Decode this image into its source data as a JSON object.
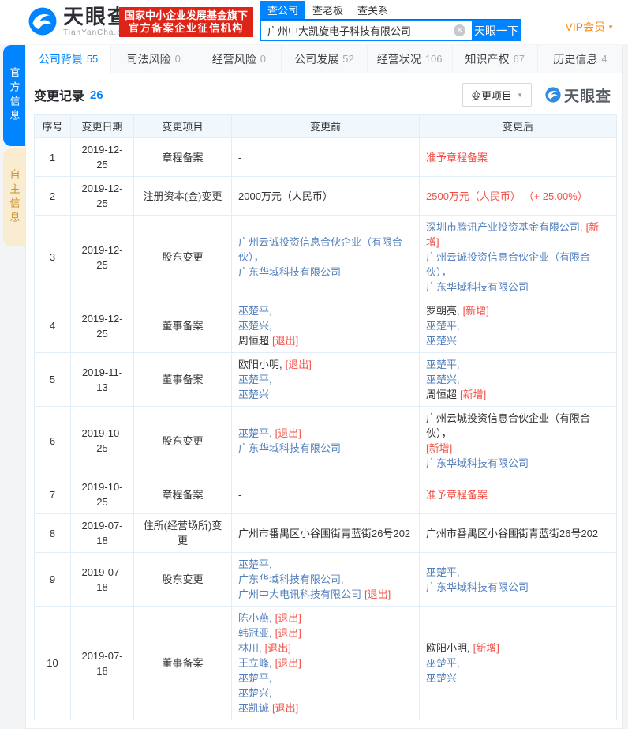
{
  "header": {
    "logo": {
      "brand": "天眼查",
      "domain": "TianYanCha.com"
    },
    "badge": {
      "line1": "国家中小企业发展基金旗下",
      "line2": "官方备案企业征信机构"
    },
    "search_tabs": [
      {
        "name": "search-tab-company",
        "label": "查公司",
        "active": true
      },
      {
        "name": "search-tab-boss",
        "label": "查老板",
        "active": false
      },
      {
        "name": "search-tab-relation",
        "label": "查关系",
        "active": false
      }
    ],
    "search": {
      "value": "广州中大凯旋电子科技有限公司",
      "button_label": "天眼一下"
    },
    "vip_label": "VIP会员"
  },
  "side_tabs": [
    {
      "name": "side-tab-official-info",
      "label": "官方信息",
      "active": true
    },
    {
      "name": "side-tab-self-info",
      "label": "自主信息",
      "active": false
    }
  ],
  "nav_tabs": [
    {
      "name": "tab-company-background",
      "label": "公司背景",
      "count": "55",
      "active": true
    },
    {
      "name": "tab-judicial-risk",
      "label": "司法风险",
      "count": "0",
      "active": false
    },
    {
      "name": "tab-operation-risk",
      "label": "经营风险",
      "count": "0",
      "active": false
    },
    {
      "name": "tab-company-development",
      "label": "公司发展",
      "count": "52",
      "active": false
    },
    {
      "name": "tab-operation-status",
      "label": "经营状况",
      "count": "106",
      "active": false
    },
    {
      "name": "tab-intellectual-property",
      "label": "知识产权",
      "count": "67",
      "active": false
    },
    {
      "name": "tab-history-info",
      "label": "历史信息",
      "count": "4",
      "active": false
    }
  ],
  "section": {
    "title": "变更记录",
    "count": "26",
    "filter_label": "变更项目",
    "watermark_label": "天眼查"
  },
  "colors": {
    "brand_blue": "#0084ff",
    "link_blue": "#5380bd",
    "alert_red": "#f25046",
    "badge_red": "#de2417",
    "vip_orange": "#ff8b17"
  },
  "table": {
    "headers": [
      "序号",
      "变更日期",
      "变更项目",
      "变更前",
      "变更后"
    ],
    "rows": [
      {
        "no": "1",
        "date": "2019-12-25",
        "item": "章程备案",
        "before": [
          [
            [
              "-",
              "plain"
            ]
          ]
        ],
        "after": [
          [
            [
              "准予章程备案",
              "red"
            ]
          ]
        ]
      },
      {
        "no": "2",
        "date": "2019-12-25",
        "item": "注册资本(金)变更",
        "before": [
          [
            [
              "2000万元（人民币）",
              "plain"
            ]
          ]
        ],
        "after": [
          [
            [
              "2500万元（人民币） （+ 25.00%）",
              "red"
            ]
          ]
        ]
      },
      {
        "no": "3",
        "date": "2019-12-25",
        "item": "股东变更",
        "before": [
          [
            [
              "广州云诚投资信息合伙企业（有限合伙），",
              "link"
            ]
          ],
          [
            [
              "广东华域科技有限公司",
              "link"
            ]
          ]
        ],
        "after": [
          [
            [
              "深圳市腾讯产业投资基金有限公司,",
              "link"
            ],
            [
              "[新增]",
              "red"
            ]
          ],
          [
            [
              "广州云诚投资信息合伙企业（有限合伙），",
              "link"
            ]
          ],
          [
            [
              "广东华域科技有限公司",
              "link"
            ]
          ]
        ]
      },
      {
        "no": "4",
        "date": "2019-12-25",
        "item": "董事备案",
        "before": [
          [
            [
              "巫楚平,",
              "link"
            ]
          ],
          [
            [
              "巫楚兴,",
              "link"
            ]
          ],
          [
            [
              "周恒超",
              "plain"
            ],
            [
              "[退出]",
              "red"
            ]
          ]
        ],
        "after": [
          [
            [
              "罗朝亮,",
              "plain"
            ],
            [
              "[新增]",
              "red"
            ]
          ],
          [
            [
              "巫楚平,",
              "link"
            ]
          ],
          [
            [
              "巫楚兴",
              "link"
            ]
          ]
        ]
      },
      {
        "no": "5",
        "date": "2019-11-13",
        "item": "董事备案",
        "before": [
          [
            [
              "欧阳小明,",
              "plain"
            ],
            [
              "[退出]",
              "red"
            ]
          ],
          [
            [
              "巫楚平,",
              "link"
            ]
          ],
          [
            [
              "巫楚兴",
              "link"
            ]
          ]
        ],
        "after": [
          [
            [
              "巫楚平,",
              "link"
            ]
          ],
          [
            [
              "巫楚兴,",
              "link"
            ]
          ],
          [
            [
              "周恒超",
              "plain"
            ],
            [
              "[新增]",
              "red"
            ]
          ]
        ]
      },
      {
        "no": "6",
        "date": "2019-10-25",
        "item": "股东变更",
        "before": [
          [
            [
              "巫楚平,",
              "link"
            ],
            [
              "[退出]",
              "red"
            ]
          ],
          [
            [
              "广东华域科技有限公司",
              "link"
            ]
          ]
        ],
        "after": [
          [
            [
              "广州云城投资信息合伙企业（有限合伙），",
              "plain"
            ]
          ],
          [
            [
              "[新增]",
              "red"
            ]
          ],
          [
            [
              "广东华域科技有限公司",
              "link"
            ]
          ]
        ]
      },
      {
        "no": "7",
        "date": "2019-10-25",
        "item": "章程备案",
        "before": [
          [
            [
              "-",
              "plain"
            ]
          ]
        ],
        "after": [
          [
            [
              "准予章程备案",
              "red"
            ]
          ]
        ]
      },
      {
        "no": "8",
        "date": "2019-07-18",
        "item": "住所(经营场所)变更",
        "before": [
          [
            [
              "广州市番禺区小谷围街青蓝街26号202",
              "plain"
            ]
          ]
        ],
        "after": [
          [
            [
              "广州市番禺区小谷围街青蓝街26号202",
              "plain"
            ]
          ]
        ]
      },
      {
        "no": "9",
        "date": "2019-07-18",
        "item": "股东变更",
        "before": [
          [
            [
              "巫楚平,",
              "link"
            ]
          ],
          [
            [
              "广东华域科技有限公司,",
              "link"
            ]
          ],
          [
            [
              "广州中大电讯科技有限公司",
              "link"
            ],
            [
              "[退出]",
              "red"
            ]
          ]
        ],
        "after": [
          [
            [
              "巫楚平,",
              "link"
            ]
          ],
          [
            [
              "广东华域科技有限公司",
              "link"
            ]
          ]
        ]
      },
      {
        "no": "10",
        "date": "2019-07-18",
        "item": "董事备案",
        "before": [
          [
            [
              "陈小燕,",
              "link"
            ],
            [
              "[退出]",
              "red"
            ]
          ],
          [
            [
              "韩冠亚,",
              "link"
            ],
            [
              "[退出]",
              "red"
            ]
          ],
          [
            [
              "林川,",
              "link"
            ],
            [
              "[退出]",
              "red"
            ]
          ],
          [
            [
              "王立峰,",
              "link"
            ],
            [
              "[退出]",
              "red"
            ]
          ],
          [
            [
              "巫楚平,",
              "link"
            ]
          ],
          [
            [
              "巫楚兴,",
              "link"
            ]
          ],
          [
            [
              "巫凯诚",
              "link"
            ],
            [
              "[退出]",
              "red"
            ]
          ]
        ],
        "after": [
          [
            [
              "欧阳小明,",
              "plain"
            ],
            [
              "[新增]",
              "red"
            ]
          ],
          [
            [
              "巫楚平,",
              "link"
            ]
          ],
          [
            [
              "巫楚兴",
              "link"
            ]
          ]
        ]
      }
    ]
  }
}
